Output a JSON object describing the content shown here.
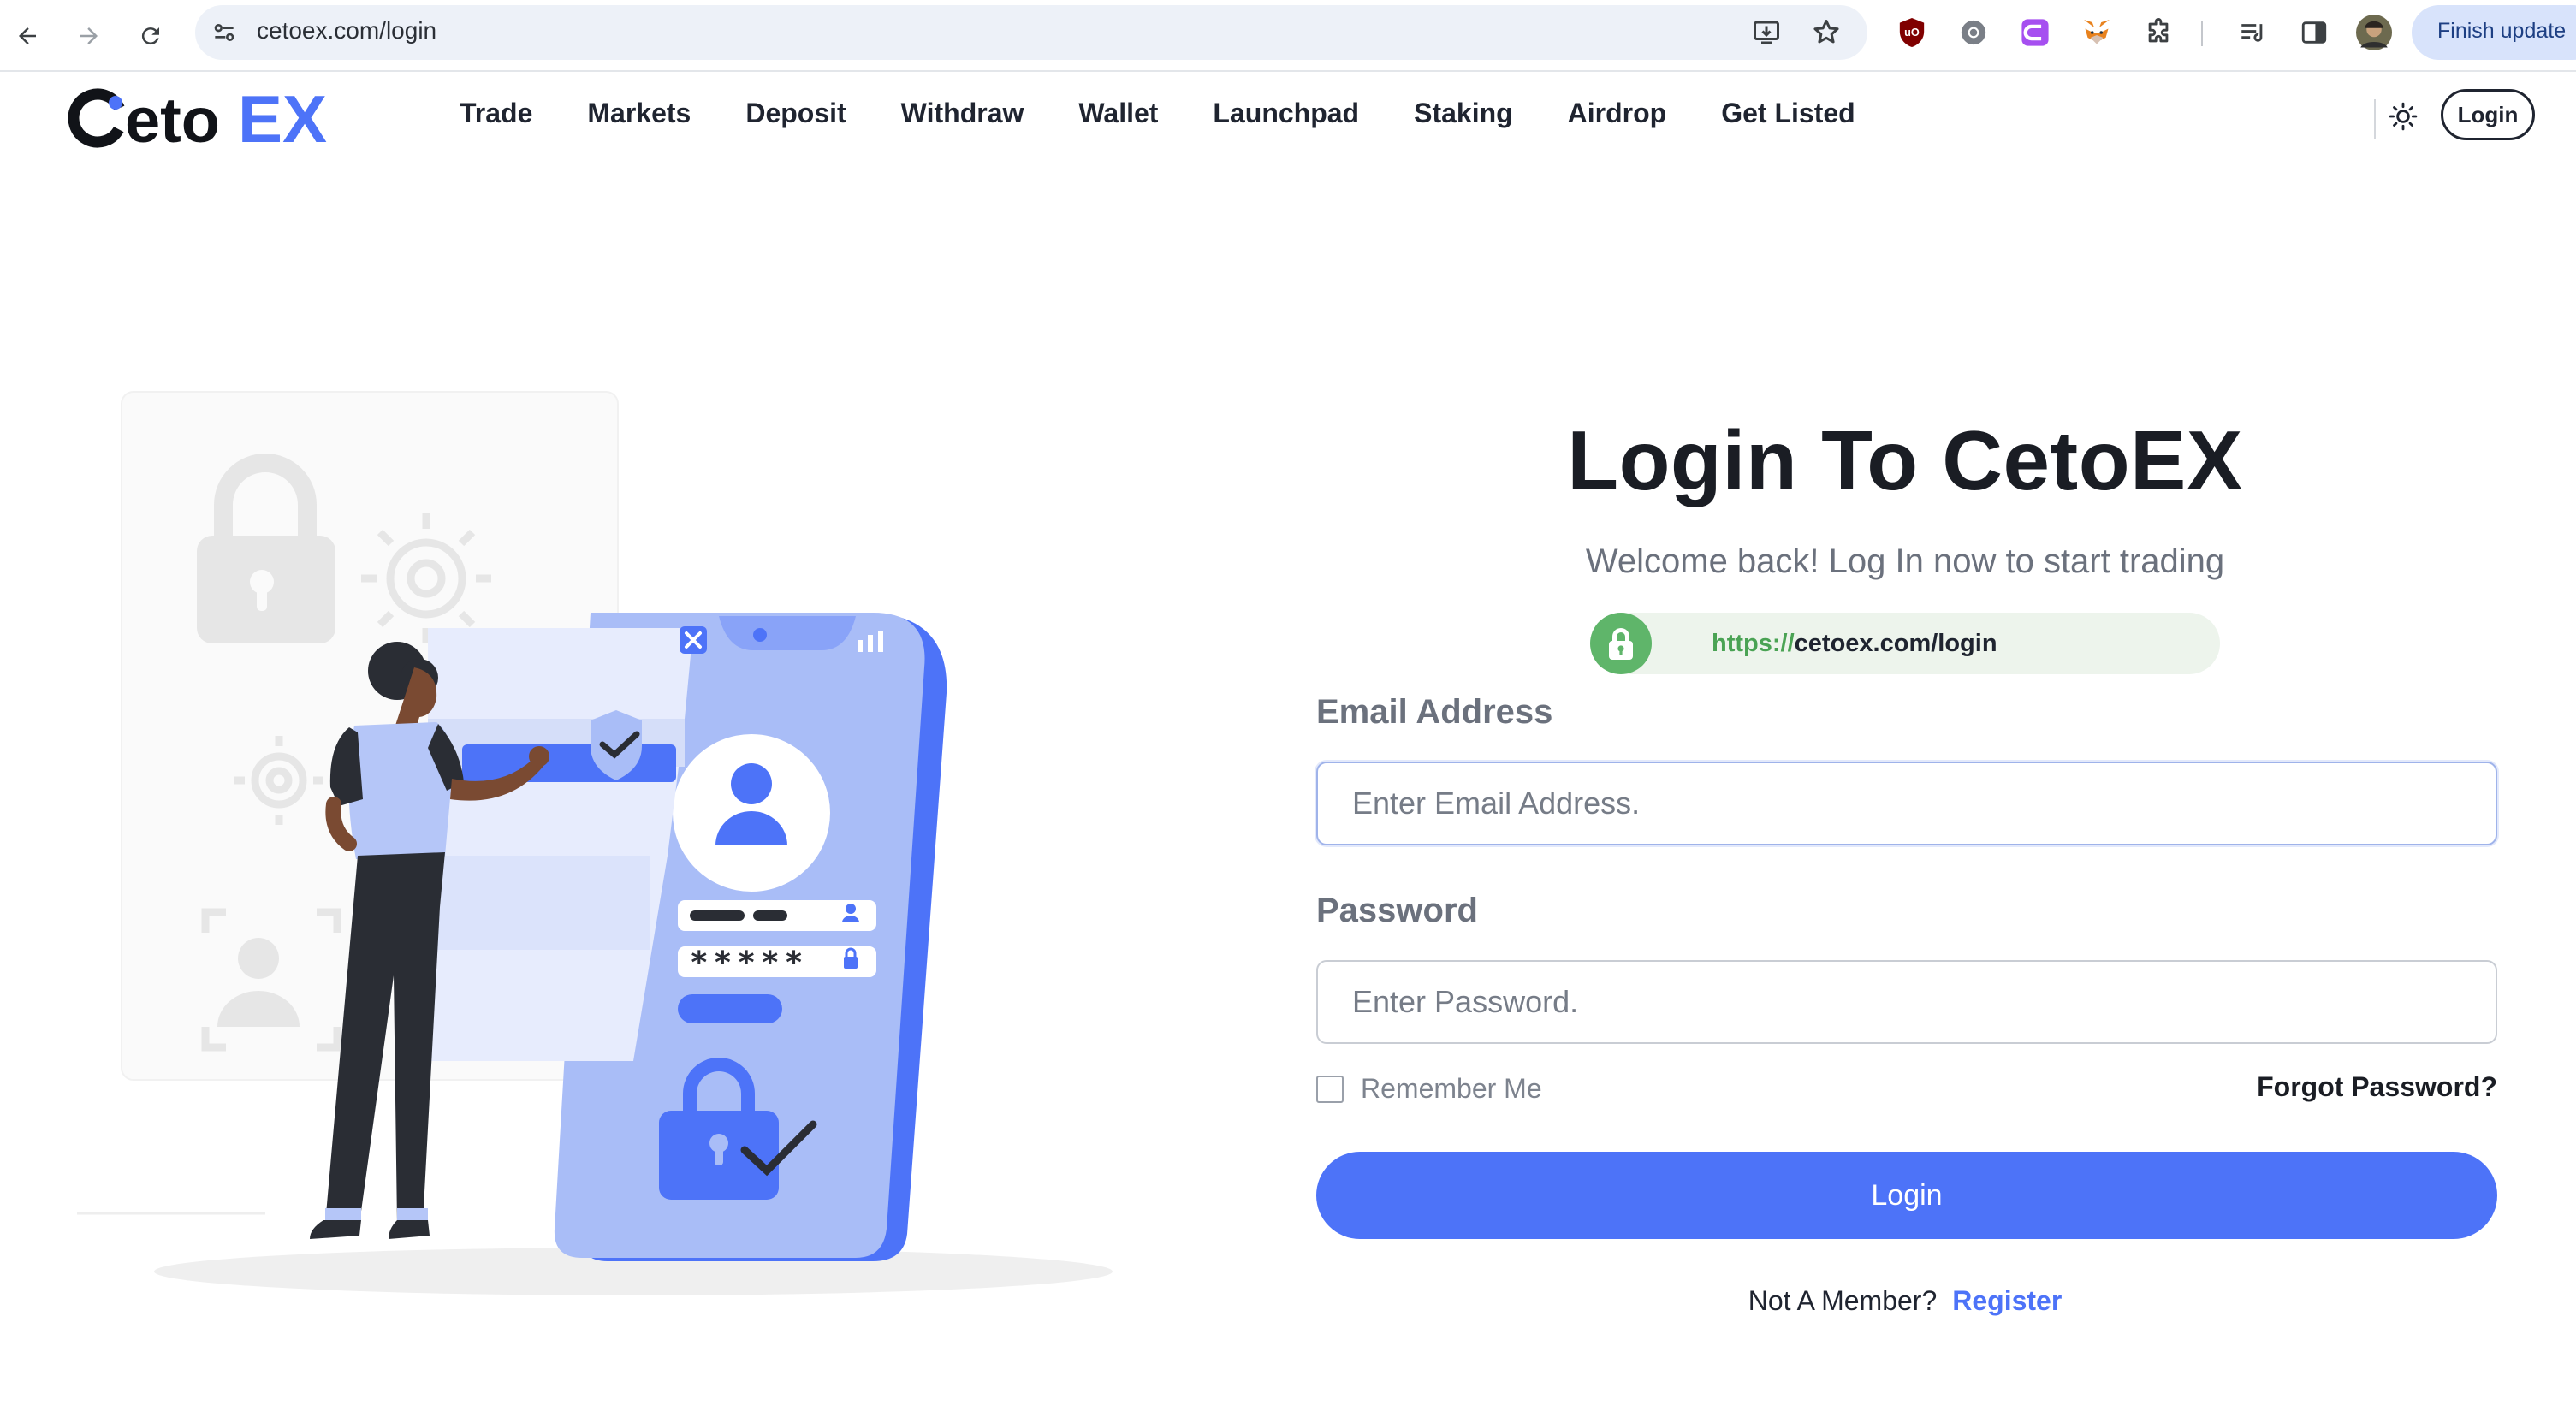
{
  "browser": {
    "url": "cetoex.com/login",
    "finish_update_label": "Finish update",
    "extensions": [
      "ublock-icon",
      "chrome-extension-icon",
      "clipper-icon",
      "metamask-fox-icon",
      "puzzle-extensions-icon",
      "reading-list-icon",
      "side-panel-icon",
      "profile-avatar"
    ]
  },
  "header": {
    "logo_text_dark": "Ceto",
    "logo_text_blue": "EX",
    "nav": [
      "Trade",
      "Markets",
      "Deposit",
      "Withdraw",
      "Wallet",
      "Launchpad",
      "Staking",
      "Airdrop",
      "Get Listed"
    ],
    "login_label": "Login"
  },
  "login": {
    "title": "Login To CetoEX",
    "subtitle": "Welcome back! Log In now to start trading",
    "secure_url_scheme": "https://",
    "secure_url_host": "cetoex.com/login",
    "email_label": "Email Address",
    "email_placeholder": "Enter Email Address.",
    "password_label": "Password",
    "password_placeholder": "Enter Password.",
    "remember_label": "Remember Me",
    "forgot_label": "Forgot Password?",
    "submit_label": "Login",
    "not_member_text": "Not A Member?",
    "register_label": "Register"
  },
  "illustration": {
    "password_mask": "*****"
  },
  "colors": {
    "brand_blue": "#4d73f8",
    "brand_dark": "#1a1d24",
    "secure_green": "#5fb56a",
    "illustration_blue": "#a9bdf7"
  }
}
